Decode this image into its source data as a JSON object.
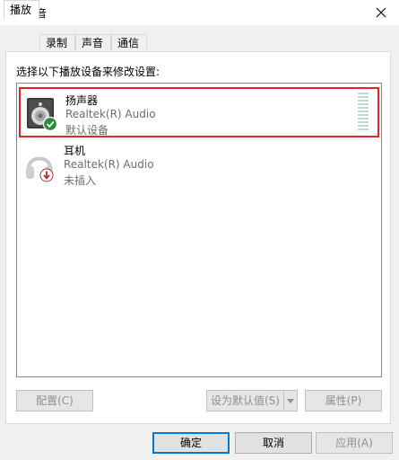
{
  "window": {
    "title": "声音",
    "icon": "speaker-icon"
  },
  "tabs": [
    {
      "label": "播放",
      "active": true
    },
    {
      "label": "录制",
      "active": false
    },
    {
      "label": "声音",
      "active": false
    },
    {
      "label": "通信",
      "active": false
    }
  ],
  "instruction": "选择以下播放设备来修改设置:",
  "devices": [
    {
      "name": "扬声器",
      "driver": "Realtek(R) Audio",
      "status": "默认设备",
      "icon": "speaker-device-icon",
      "badge": "default-check-icon",
      "selected": true
    },
    {
      "name": "耳机",
      "driver": "Realtek(R) Audio",
      "status": "未插入",
      "icon": "headphones-icon",
      "badge": "unplugged-arrow-icon",
      "selected": false
    }
  ],
  "list_buttons": {
    "configure": "配置(C)",
    "set_default": "设为默认值(S)",
    "properties": "属性(P)"
  },
  "dialog_buttons": {
    "ok": "确定",
    "cancel": "取消",
    "apply": "应用(A)"
  },
  "colors": {
    "selection_border": "#e0262b",
    "default_button_border": "#0078d7",
    "check_badge": "#2e8b3a",
    "unplugged_badge": "#c4282b"
  }
}
